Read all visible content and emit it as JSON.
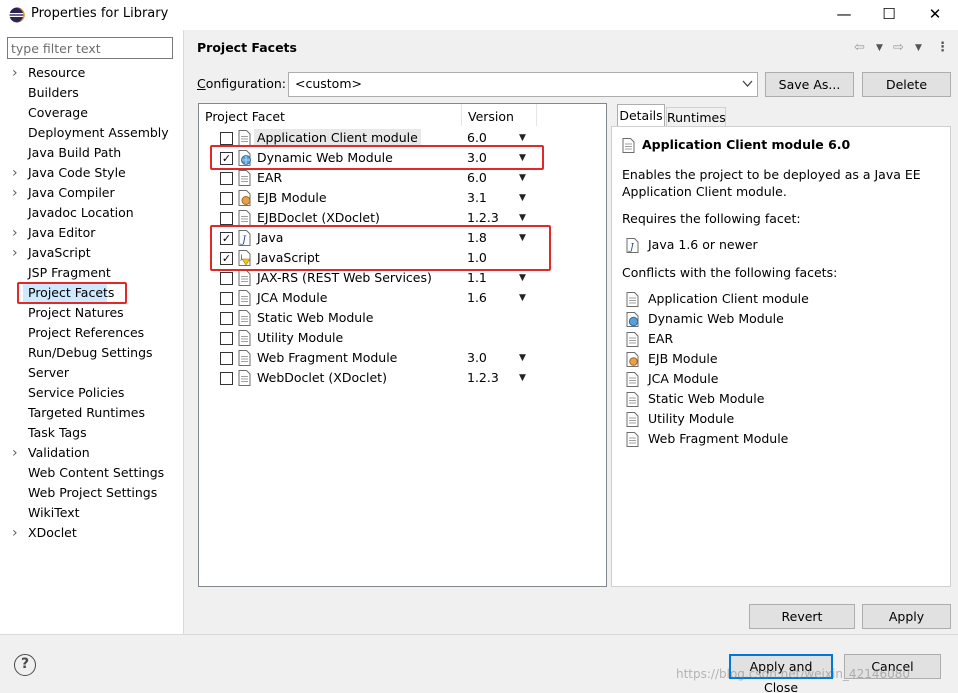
{
  "window": {
    "title": "Properties for Library",
    "minimize": "—",
    "maximize": "☐",
    "close": "✕"
  },
  "sidebar": {
    "filter_placeholder": "type filter text",
    "items": [
      {
        "label": "Resource",
        "expandable": true
      },
      {
        "label": "Builders",
        "expandable": false
      },
      {
        "label": "Coverage",
        "expandable": false
      },
      {
        "label": "Deployment Assembly",
        "expandable": false
      },
      {
        "label": "Java Build Path",
        "expandable": false
      },
      {
        "label": "Java Code Style",
        "expandable": true
      },
      {
        "label": "Java Compiler",
        "expandable": true
      },
      {
        "label": "Javadoc Location",
        "expandable": false
      },
      {
        "label": "Java Editor",
        "expandable": true
      },
      {
        "label": "JavaScript",
        "expandable": true
      },
      {
        "label": "JSP Fragment",
        "expandable": false
      },
      {
        "label": "Project Facets",
        "expandable": false,
        "selected": true
      },
      {
        "label": "Project Natures",
        "expandable": false
      },
      {
        "label": "Project References",
        "expandable": false
      },
      {
        "label": "Run/Debug Settings",
        "expandable": false
      },
      {
        "label": "Server",
        "expandable": false
      },
      {
        "label": "Service Policies",
        "expandable": false
      },
      {
        "label": "Targeted Runtimes",
        "expandable": false
      },
      {
        "label": "Task Tags",
        "expandable": false
      },
      {
        "label": "Validation",
        "expandable": true
      },
      {
        "label": "Web Content Settings",
        "expandable": false
      },
      {
        "label": "Web Project Settings",
        "expandable": false
      },
      {
        "label": "WikiText",
        "expandable": false
      },
      {
        "label": "XDoclet",
        "expandable": true
      }
    ]
  },
  "page": {
    "title": "Project Facets",
    "configuration_label": "Configuration:",
    "configuration_value": "<custom>",
    "save_as_label": "Save As...",
    "delete_label": "Delete"
  },
  "facets": {
    "col_facet": "Project Facet",
    "col_version": "Version",
    "rows": [
      {
        "name": "Application Client module",
        "version": "6.0",
        "checked": false,
        "dropdown": true,
        "icon": "module-icon"
      },
      {
        "name": "Dynamic Web Module",
        "version": "3.0",
        "checked": true,
        "dropdown": true,
        "icon": "web-module-icon"
      },
      {
        "name": "EAR",
        "version": "6.0",
        "checked": false,
        "dropdown": true,
        "icon": "module-icon"
      },
      {
        "name": "EJB Module",
        "version": "3.1",
        "checked": false,
        "dropdown": true,
        "icon": "ejb-module-icon"
      },
      {
        "name": "EJBDoclet (XDoclet)",
        "version": "1.2.3",
        "checked": false,
        "dropdown": true,
        "icon": "module-icon"
      },
      {
        "name": "Java",
        "version": "1.8",
        "checked": true,
        "dropdown": true,
        "icon": "java-icon"
      },
      {
        "name": "JavaScript",
        "version": "1.0",
        "checked": true,
        "dropdown": false,
        "icon": "javascript-icon"
      },
      {
        "name": "JAX-RS (REST Web Services)",
        "version": "1.1",
        "checked": false,
        "dropdown": true,
        "icon": "module-icon"
      },
      {
        "name": "JCA Module",
        "version": "1.6",
        "checked": false,
        "dropdown": true,
        "icon": "module-icon"
      },
      {
        "name": "Static Web Module",
        "version": "",
        "checked": false,
        "dropdown": false,
        "icon": "module-icon"
      },
      {
        "name": "Utility Module",
        "version": "",
        "checked": false,
        "dropdown": false,
        "icon": "module-icon"
      },
      {
        "name": "Web Fragment Module",
        "version": "3.0",
        "checked": false,
        "dropdown": true,
        "icon": "module-icon"
      },
      {
        "name": "WebDoclet (XDoclet)",
        "version": "1.2.3",
        "checked": false,
        "dropdown": true,
        "icon": "module-icon"
      }
    ]
  },
  "details": {
    "tab_details": "Details",
    "tab_runtimes": "Runtimes",
    "heading": "Application Client module 6.0",
    "description_line1": "Enables the project to be deployed as a Java EE",
    "description_line2": "Application Client module.",
    "requires_label": "Requires the following facet:",
    "requires": [
      "Java 1.6 or newer"
    ],
    "conflicts_label": "Conflicts with the following facets:",
    "conflicts": [
      "Application Client module",
      "Dynamic Web Module",
      "EAR",
      "EJB Module",
      "JCA Module",
      "Static Web Module",
      "Utility Module",
      "Web Fragment Module"
    ]
  },
  "buttons": {
    "revert": "Revert",
    "apply": "Apply",
    "apply_close": "Apply and Close",
    "cancel": "Cancel",
    "help": "?"
  },
  "watermark": "https://blog.csdn.net/weixin_42146080",
  "colors": {
    "highlight": "#e02a2a",
    "selection": "#cde8ff",
    "default_button_border": "#0078d7"
  }
}
